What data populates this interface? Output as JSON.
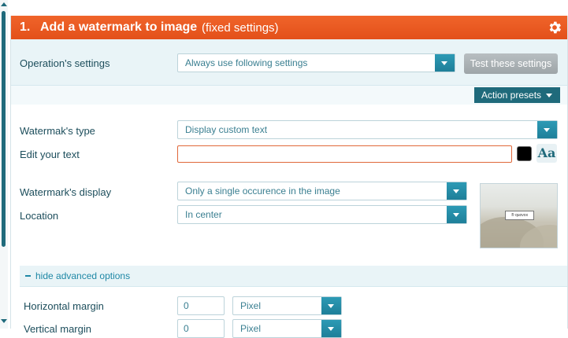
{
  "header": {
    "number": "1.",
    "title": "Add a watermark to image",
    "subtitle": "(fixed settings)"
  },
  "operation_settings": {
    "label": "Operation's settings",
    "value": "Always use following settings",
    "test_button": "Test these settings"
  },
  "action_presets": {
    "label": "Action presets"
  },
  "watermark_type": {
    "label": "Watermak's type",
    "value": "Display custom text"
  },
  "edit_text": {
    "label": "Edit your text",
    "value": "",
    "color": "#000000",
    "font_button": "Aa"
  },
  "watermark_display": {
    "label": "Watermark's display",
    "value": "Only a single occurence in the image"
  },
  "location": {
    "label": "Location",
    "value": "In center"
  },
  "preview": {
    "watermark_text": "® quovox"
  },
  "advanced": {
    "toggle_label": "hide advanced options"
  },
  "horizontal_margin": {
    "label": "Horizontal margin",
    "value": "0",
    "unit": "Pixel"
  },
  "vertical_margin": {
    "label": "Vertical margin",
    "value": "0",
    "unit": "Pixel"
  },
  "colors": {
    "accent_orange": "#e3501a",
    "teal": "#1f6a7b",
    "select_button": "#2d9ab5"
  }
}
